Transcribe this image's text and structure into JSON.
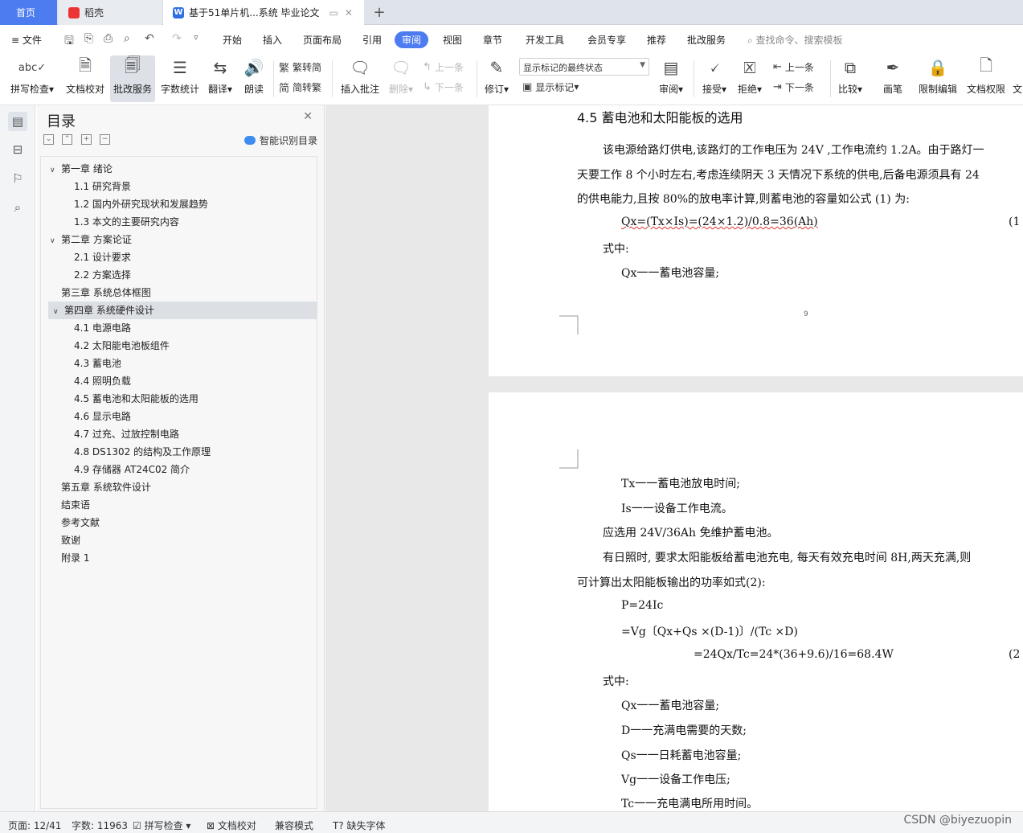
{
  "tabs": {
    "home": "首页",
    "daoke": "稻壳",
    "doc": "基于51单片机...系统 毕业论文",
    "add": "+",
    "doc_ctl_pin": "▭",
    "doc_ctl_close": "✕"
  },
  "menu": {
    "file": "≡ 文件",
    "items": [
      "开始",
      "插入",
      "页面布局",
      "引用",
      "审阅",
      "视图",
      "章节",
      "开发工具",
      "会员专享",
      "推荐",
      "批改服务"
    ],
    "search": "查找命令、搜索模板"
  },
  "ribbon": {
    "spell": "拼写检查",
    "doc_proof": "文档校对",
    "correction": "批改服务",
    "word_count": "字数统计",
    "translate": "翻译",
    "read_aloud": "朗读",
    "to_traditional": "繁转简",
    "to_simplified": "简转繁",
    "insert_comment": "插入批注",
    "delete": "删除",
    "prev_comment": "上一条",
    "next_comment": "下一条",
    "track": "修订",
    "markup_state": "显示标记的最终状态",
    "show_markup": "显示标记",
    "review": "审阅",
    "accept": "接受",
    "reject": "拒绝",
    "prev": "上一条",
    "next": "下一条",
    "compare": "比较",
    "pen": "画笔",
    "restrict": "限制编辑",
    "permission": "文档权限",
    "more": "文"
  },
  "toc": {
    "title": "目录",
    "smart": "智能识别目录",
    "items": [
      "第一章 绪论",
      "1.1 研究背景",
      "1.2 国内外研究现状和发展趋势",
      "1.3 本文的主要研究内容",
      "第二章 方案论证",
      "2.1  设计要求",
      "2.2  方案选择",
      "第三章  系统总体框图",
      "第四章  系统硬件设计",
      "4.1  电源电路",
      "4.2  太阳能电池板组件",
      "4.3  蓄电池",
      "4.4  照明负载",
      "4.5  蓄电池和太阳能板的选用",
      "4.6  显示电路",
      "4.7  过充、过放控制电路",
      "4.8 DS1302 的结构及工作原理",
      "4.9  存储器 AT24C02 简介",
      "第五章  系统软件设计",
      "结束语",
      "参考文献",
      "致谢",
      "附录 1"
    ]
  },
  "page1": {
    "heading": "4.5  蓄电池和太阳能板的选用",
    "p1": "该电源给路灯供电,该路灯的工作电压为 24V ,工作电流约 1.2A。由于路灯一",
    "p2": "天要工作 8 个小时左右,考虑连续阴天 3 天情况下系统的供电,后备电源须具有 24",
    "p3": "的供电能力,且按 80%的放电率计算,则蓄电池的容量如公式 (1) 为:",
    "f1": "Qx=(Tx×Is)=(24×1.2)/0.8=36(Ah)",
    "f1_no": "(1",
    "where": "式中:",
    "qx": "Qx一一蓄电池容量;",
    "page_no": "9"
  },
  "page2": {
    "tx": "Tx一一蓄电池放电时间;",
    "is": "Is一一设备工作电流。",
    "choose": "应选用 24V/36Ah 免维护蓄电池。",
    "p1": "有日照时, 要求太阳能板给蓄电池充电, 每天有效充电时间 8H,两天充满,则",
    "p2": "可计算出太阳能板输出的功率如式(2):",
    "f1": "P=24Ic",
    "f2": "=Vg〔Qx+Qs ×(D-1)〕/(Tc ×D)",
    "f3": "=24Qx/Tc=24*(36+9.6)/16=68.4W",
    "f3_no": "(2",
    "where": "式中:",
    "qx": "Qx一一蓄电池容量;",
    "d": "D一一充满电需要的天数;",
    "qs": "Qs一一日耗蓄电池容量;",
    "vg": "Vg一一设备工作电压;",
    "tc": "Tc一一充电满电所用时间。"
  },
  "status": {
    "page": "页面: 12/41",
    "words": "字数: 11963",
    "spell": "拼写检查",
    "proof": "文档校对",
    "compat": "兼容模式",
    "missing_font": "缺失字体",
    "watermark": "CSDN @biyezuopin"
  }
}
